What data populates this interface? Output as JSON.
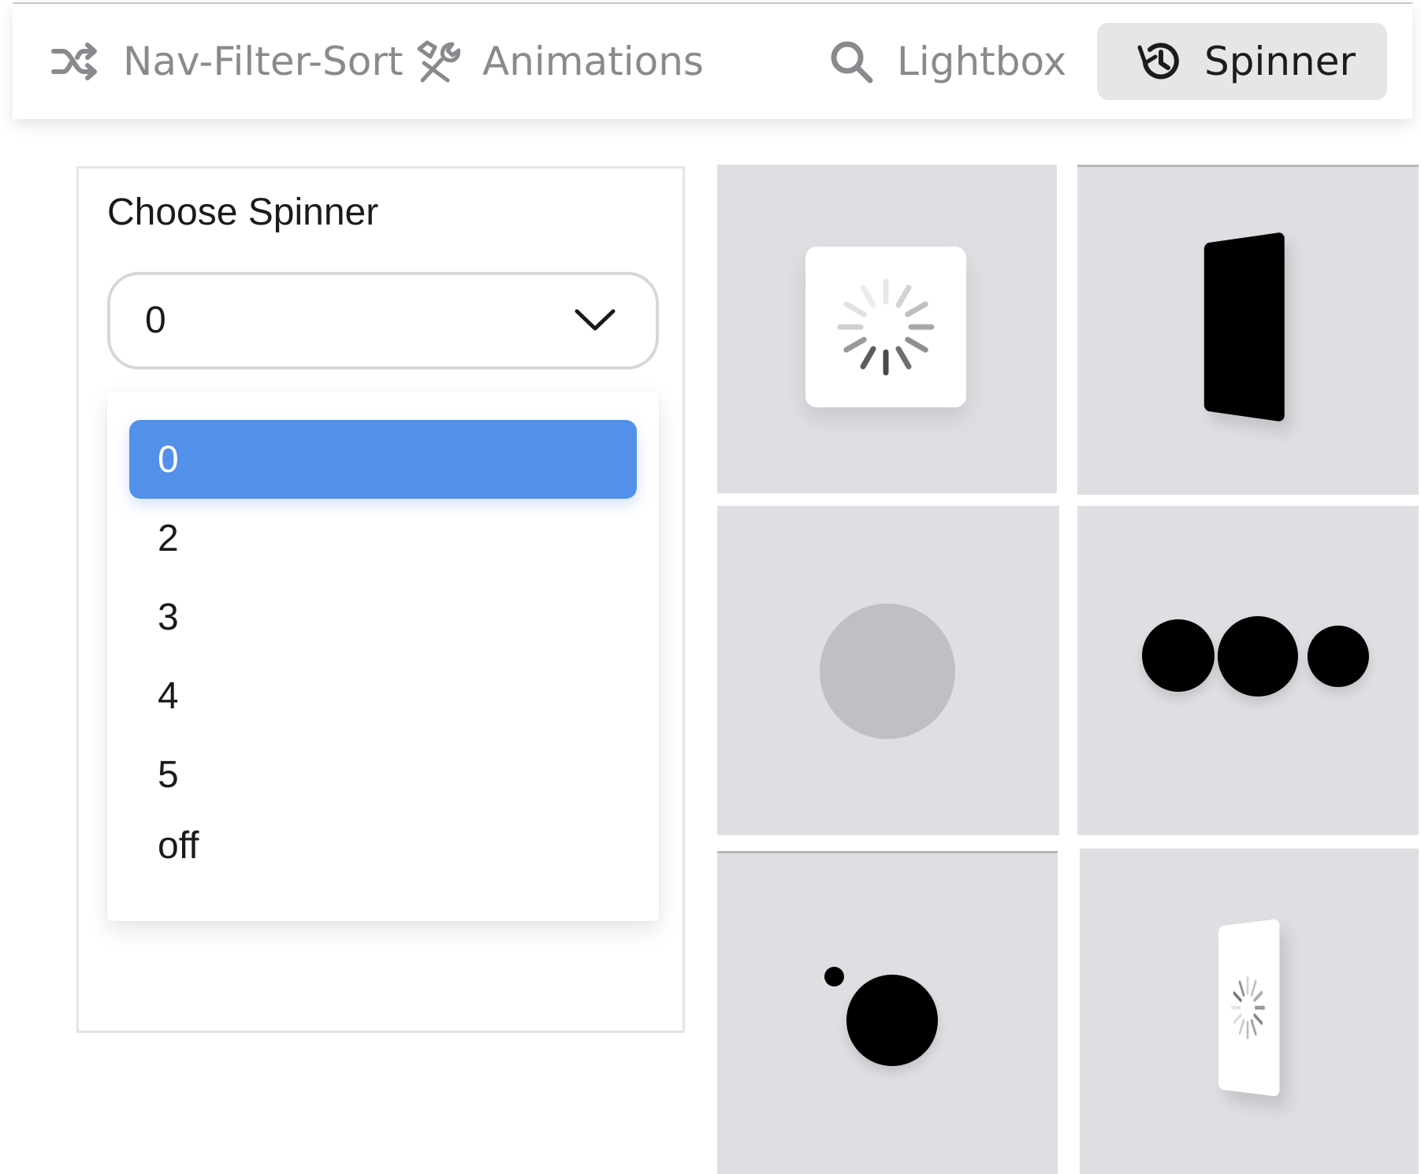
{
  "nav": {
    "tabs": [
      {
        "label": "Nav-Filter-Sort",
        "icon": "shuffle-icon",
        "active": false
      },
      {
        "label": "Animations",
        "icon": "tools-icon",
        "active": false
      },
      {
        "label": "Lightbox",
        "icon": "search-icon",
        "active": false
      },
      {
        "label": "Spinner",
        "icon": "history-icon",
        "active": true
      }
    ]
  },
  "panel": {
    "title": "Choose Spinner",
    "select": {
      "value": "0",
      "icon": "chevron-down-icon"
    },
    "options": [
      "0",
      "2",
      "3",
      "4",
      "5",
      "off"
    ],
    "selected_index": 0
  },
  "previews": [
    {
      "name": "spinner-preview-0",
      "style": "white card with ticks spinner"
    },
    {
      "name": "spinner-preview-2",
      "style": "black rotating card"
    },
    {
      "name": "spinner-preview-3",
      "style": "gray pulsing ball"
    },
    {
      "name": "spinner-preview-4",
      "style": "three black dots"
    },
    {
      "name": "spinner-preview-5",
      "style": "orbiting dots"
    },
    {
      "name": "spinner-preview-6",
      "style": "white rotating card with ticks"
    }
  ],
  "colors": {
    "accent": "#5390e9",
    "preview_bg": "#dfdfe3",
    "active_tab_bg": "#e6e6e9",
    "text_muted": "#8a8a8e"
  }
}
